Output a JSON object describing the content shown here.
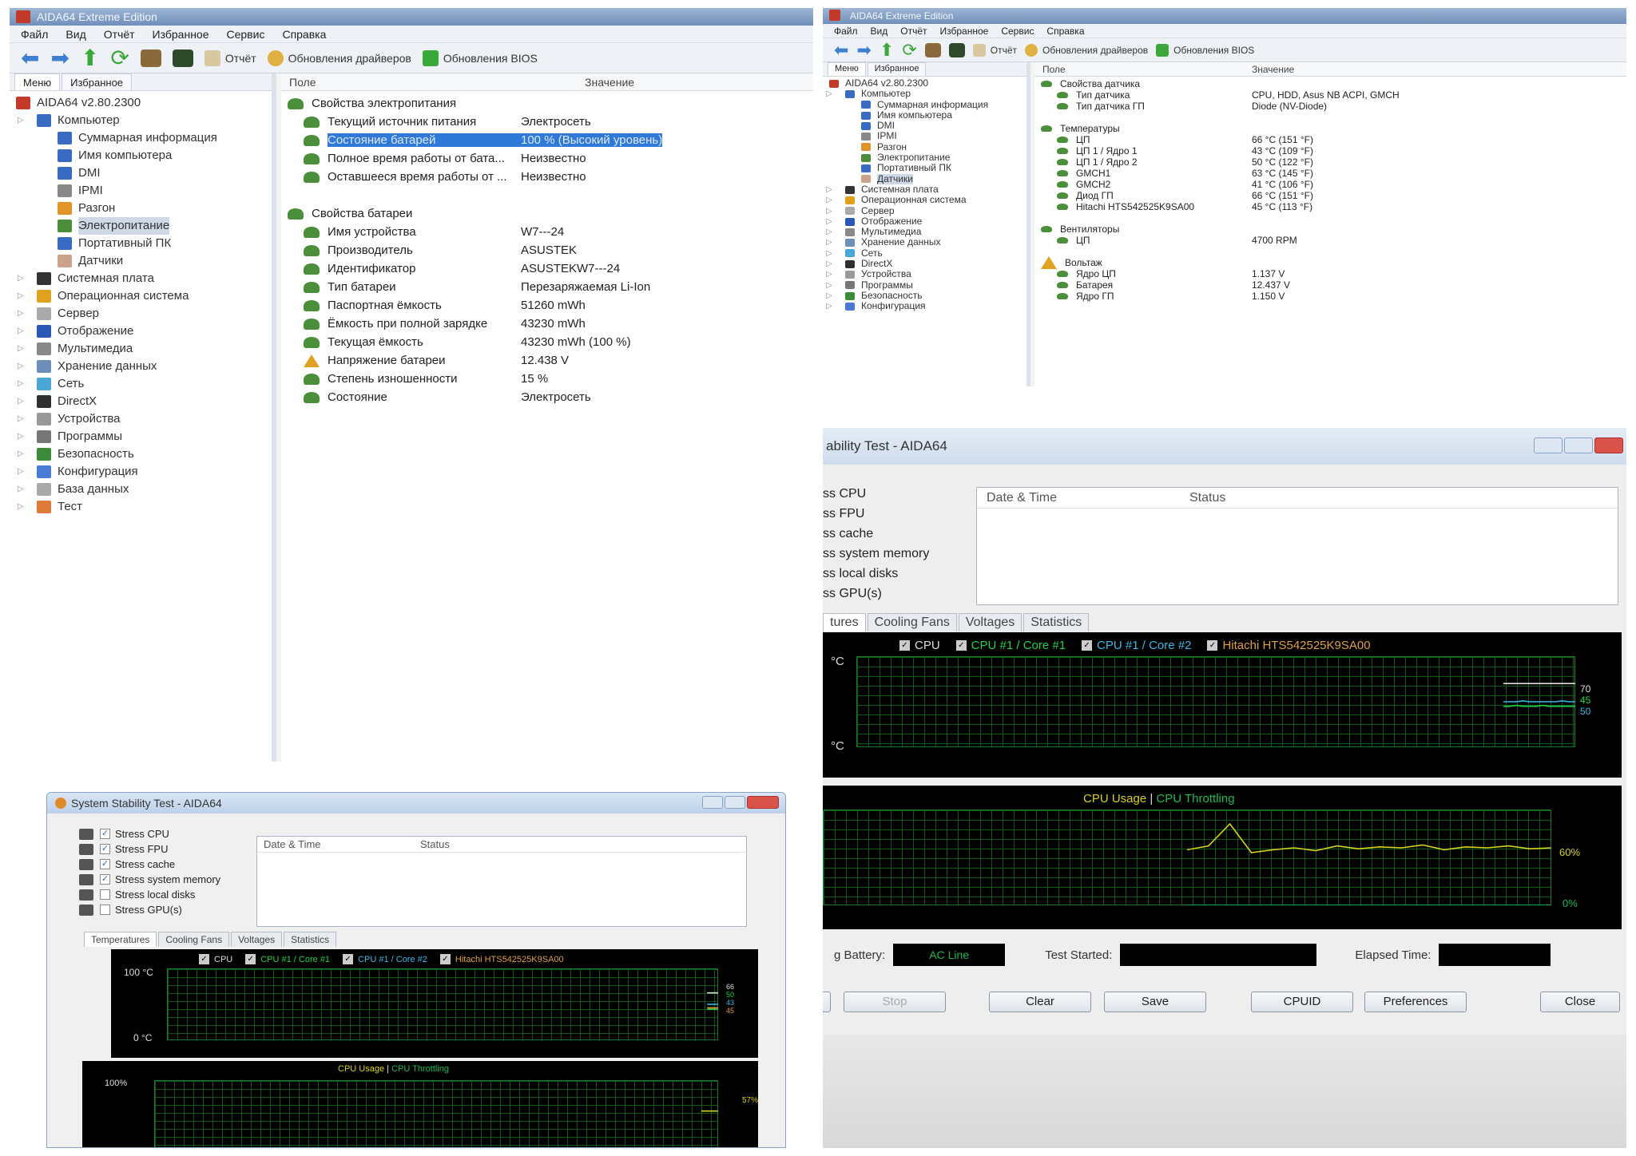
{
  "aida_left": {
    "title": "AIDA64 Extreme Edition",
    "menu": [
      "Файл",
      "Вид",
      "Отчёт",
      "Избранное",
      "Сервис",
      "Справка"
    ],
    "toolbar": {
      "report": "Отчёт",
      "drivers": "Обновления драйверов",
      "bios": "Обновления BIOS"
    },
    "tabs": [
      "Меню",
      "Избранное"
    ],
    "tree": [
      {
        "label": "AIDA64 v2.80.2300",
        "level": 0,
        "icon": "aida-icon",
        "color": "#c43a2a"
      },
      {
        "label": "Компьютер",
        "level": 1,
        "icon": "computer-icon",
        "color": "#3a6bc4"
      },
      {
        "label": "Суммарная информация",
        "level": 2,
        "icon": "summary-icon",
        "color": "#3a6bc4"
      },
      {
        "label": "Имя компьютера",
        "level": 2,
        "icon": "computer-name-icon",
        "color": "#3a6bc4"
      },
      {
        "label": "DMI",
        "level": 2,
        "icon": "dmi-icon",
        "color": "#3a6bc4"
      },
      {
        "label": "IPMI",
        "level": 2,
        "icon": "ipmi-icon",
        "color": "#888"
      },
      {
        "label": "Разгон",
        "level": 2,
        "icon": "overclock-icon",
        "color": "#e0942a"
      },
      {
        "label": "Электропитание",
        "level": 2,
        "icon": "power-icon",
        "color": "#4b8f3a",
        "selected": true
      },
      {
        "label": "Портативный ПК",
        "level": 2,
        "icon": "laptop-icon",
        "color": "#3a6bc4"
      },
      {
        "label": "Датчики",
        "level": 2,
        "icon": "sensors-icon",
        "color": "#c9a48a"
      },
      {
        "label": "Системная плата",
        "level": 1,
        "icon": "motherboard-icon",
        "color": "#333"
      },
      {
        "label": "Операционная система",
        "level": 1,
        "icon": "os-icon",
        "color": "#e0a020"
      },
      {
        "label": "Сервер",
        "level": 1,
        "icon": "server-icon",
        "color": "#aaa"
      },
      {
        "label": "Отображение",
        "level": 1,
        "icon": "display-icon",
        "color": "#2a58b8"
      },
      {
        "label": "Мультимедиа",
        "level": 1,
        "icon": "multimedia-icon",
        "color": "#888"
      },
      {
        "label": "Хранение данных",
        "level": 1,
        "icon": "storage-icon",
        "color": "#6f8fbb"
      },
      {
        "label": "Сеть",
        "level": 1,
        "icon": "network-icon",
        "color": "#4aa8d8"
      },
      {
        "label": "DirectX",
        "level": 1,
        "icon": "directx-icon",
        "color": "#2f2f2f"
      },
      {
        "label": "Устройства",
        "level": 1,
        "icon": "devices-icon",
        "color": "#999"
      },
      {
        "label": "Программы",
        "level": 1,
        "icon": "programs-icon",
        "color": "#777"
      },
      {
        "label": "Безопасность",
        "level": 1,
        "icon": "security-icon",
        "color": "#3a8a3a"
      },
      {
        "label": "Конфигурация",
        "level": 1,
        "icon": "config-icon",
        "color": "#4a7ad8"
      },
      {
        "label": "База данных",
        "level": 1,
        "icon": "database-icon",
        "color": "#aaa"
      },
      {
        "label": "Тест",
        "level": 1,
        "icon": "test-icon",
        "color": "#e07a3a"
      }
    ],
    "col_field": "Поле",
    "col_value": "Значение",
    "rows": [
      {
        "field": "Свойства электропитания",
        "value": "",
        "type": "group"
      },
      {
        "field": "Текущий источник питания",
        "value": "Электросеть"
      },
      {
        "field": "Состояние батарей",
        "value": "100 % (Высокий уровень)",
        "highlight": true
      },
      {
        "field": "Полное время работы от бата...",
        "value": "Неизвестно"
      },
      {
        "field": "Оставшееся время работы от ...",
        "value": "Неизвестно"
      },
      {
        "field": "",
        "value": "",
        "type": "spacer"
      },
      {
        "field": "Свойства батареи",
        "value": "",
        "type": "group"
      },
      {
        "field": "Имя устройства",
        "value": "W7---24"
      },
      {
        "field": "Производитель",
        "value": "ASUSTEK"
      },
      {
        "field": "Идентификатор",
        "value": "ASUSTEKW7---24"
      },
      {
        "field": "Тип батареи",
        "value": "Перезаряжаемая Li-Ion"
      },
      {
        "field": "Паспортная ёмкость",
        "value": "51260 mWh"
      },
      {
        "field": "Ёмкость при полной зарядке",
        "value": "43230 mWh"
      },
      {
        "field": "Текущая ёмкость",
        "value": "43230 mWh  (100 %)"
      },
      {
        "field": "Напряжение батареи",
        "value": "12.438 V",
        "warn": true
      },
      {
        "field": "Степень изношенности",
        "value": "15 %"
      },
      {
        "field": "Состояние",
        "value": "Электросеть"
      }
    ]
  },
  "aida_right": {
    "title": "AIDA64 Extreme Edition",
    "menu": [
      "Файл",
      "Вид",
      "Отчёт",
      "Избранное",
      "Сервис",
      "Справка"
    ],
    "toolbar": {
      "report": "Отчёт",
      "drivers": "Обновления драйверов",
      "bios": "Обновления BIOS"
    },
    "tabs": [
      "Меню",
      "Избранное"
    ],
    "tree": [
      {
        "label": "AIDA64 v2.80.2300",
        "level": 0,
        "icon": "aida-icon",
        "color": "#c43a2a"
      },
      {
        "label": "Компьютер",
        "level": 1,
        "icon": "computer-icon",
        "color": "#3a6bc4"
      },
      {
        "label": "Суммарная информация",
        "level": 2,
        "icon": "summary-icon",
        "color": "#3a6bc4"
      },
      {
        "label": "Имя компьютера",
        "level": 2,
        "icon": "computer-name-icon",
        "color": "#3a6bc4"
      },
      {
        "label": "DMI",
        "level": 2,
        "icon": "dmi-icon",
        "color": "#3a6bc4"
      },
      {
        "label": "IPMI",
        "level": 2,
        "icon": "ipmi-icon",
        "color": "#888"
      },
      {
        "label": "Разгон",
        "level": 2,
        "icon": "overclock-icon",
        "color": "#e0942a"
      },
      {
        "label": "Электропитание",
        "level": 2,
        "icon": "power-icon",
        "color": "#4b8f3a"
      },
      {
        "label": "Портативный ПК",
        "level": 2,
        "icon": "laptop-icon",
        "color": "#3a6bc4"
      },
      {
        "label": "Датчики",
        "level": 2,
        "icon": "sensors-icon",
        "color": "#c9a48a",
        "selected": true
      },
      {
        "label": "Системная плата",
        "level": 1,
        "icon": "motherboard-icon",
        "color": "#333"
      },
      {
        "label": "Операционная система",
        "level": 1,
        "icon": "os-icon",
        "color": "#e0a020"
      },
      {
        "label": "Сервер",
        "level": 1,
        "icon": "server-icon",
        "color": "#aaa"
      },
      {
        "label": "Отображение",
        "level": 1,
        "icon": "display-icon",
        "color": "#2a58b8"
      },
      {
        "label": "Мультимедиа",
        "level": 1,
        "icon": "multimedia-icon",
        "color": "#888"
      },
      {
        "label": "Хранение данных",
        "level": 1,
        "icon": "storage-icon",
        "color": "#6f8fbb"
      },
      {
        "label": "Сеть",
        "level": 1,
        "icon": "network-icon",
        "color": "#4aa8d8"
      },
      {
        "label": "DirectX",
        "level": 1,
        "icon": "directx-icon",
        "color": "#2f2f2f"
      },
      {
        "label": "Устройства",
        "level": 1,
        "icon": "devices-icon",
        "color": "#999"
      },
      {
        "label": "Программы",
        "level": 1,
        "icon": "programs-icon",
        "color": "#777"
      },
      {
        "label": "Безопасность",
        "level": 1,
        "icon": "security-icon",
        "color": "#3a8a3a"
      },
      {
        "label": "Конфигурация",
        "level": 1,
        "icon": "config-icon",
        "color": "#4a7ad8"
      }
    ],
    "col_field": "Поле",
    "col_value": "Значение",
    "rows": [
      {
        "field": "Свойства датчика",
        "value": "",
        "type": "group"
      },
      {
        "field": "Тип датчика",
        "value": "CPU, HDD, Asus NB ACPI, GMCH"
      },
      {
        "field": "Тип датчика ГП",
        "value": "Diode  (NV-Diode)"
      },
      {
        "field": "",
        "value": "",
        "type": "spacer"
      },
      {
        "field": "Температуры",
        "value": "",
        "type": "group"
      },
      {
        "field": "ЦП",
        "value": "66 °C  (151 °F)"
      },
      {
        "field": "ЦП 1 / Ядро 1",
        "value": "43 °C  (109 °F)"
      },
      {
        "field": "ЦП 1 / Ядро 2",
        "value": "50 °C  (122 °F)"
      },
      {
        "field": "GMCH1",
        "value": "63 °C  (145 °F)"
      },
      {
        "field": "GMCH2",
        "value": "41 °C  (106 °F)"
      },
      {
        "field": "Диод ГП",
        "value": "66 °C  (151 °F)"
      },
      {
        "field": "Hitachi HTS542525K9SA00",
        "value": "45 °C  (113 °F)"
      },
      {
        "field": "",
        "value": "",
        "type": "spacer"
      },
      {
        "field": "Вентиляторы",
        "value": "",
        "type": "group"
      },
      {
        "field": "ЦП",
        "value": "4700 RPM"
      },
      {
        "field": "",
        "value": "",
        "type": "spacer"
      },
      {
        "field": "Вольтаж",
        "value": "",
        "type": "group",
        "warn": true
      },
      {
        "field": "Ядро ЦП",
        "value": "1.137 V"
      },
      {
        "field": "Батарея",
        "value": "12.437 V"
      },
      {
        "field": "Ядро ГП",
        "value": "1.150 V"
      }
    ]
  },
  "stab_small": {
    "title": "System Stability Test - AIDA64",
    "checks": [
      {
        "label": "Stress CPU",
        "checked": true,
        "icon": "cpu-icon"
      },
      {
        "label": "Stress FPU",
        "checked": true,
        "icon": "fpu-icon"
      },
      {
        "label": "Stress cache",
        "checked": true,
        "icon": "cache-icon"
      },
      {
        "label": "Stress system memory",
        "checked": true,
        "icon": "memory-icon"
      },
      {
        "label": "Stress local disks",
        "checked": false,
        "icon": "disk-icon"
      },
      {
        "label": "Stress GPU(s)",
        "checked": false,
        "icon": "gpu-icon"
      }
    ],
    "log_cols": [
      "Date & Time",
      "Status"
    ],
    "tabs": [
      "Temperatures",
      "Cooling Fans",
      "Voltages",
      "Statistics"
    ],
    "legend": [
      "CPU",
      "CPU #1 / Core #1",
      "CPU #1 / Core #2",
      "Hitachi HTS542525K9SA00"
    ],
    "temp_top": "100 °C",
    "temp_bottom": "0 °C",
    "temp_vals": [
      "66",
      "50",
      "43",
      "45"
    ],
    "usage_title": "CPU Usage",
    "throttle_title": "CPU Throttling",
    "usage_top": "100%",
    "usage_val": "57%"
  },
  "stab_big": {
    "title": "ability Test - AIDA64",
    "checks": [
      "ss CPU",
      "ss FPU",
      "ss cache",
      "ss system memory",
      "ss local disks",
      "ss GPU(s)"
    ],
    "log_cols": [
      "Date & Time",
      "Status"
    ],
    "tabs": [
      "tures",
      "Cooling Fans",
      "Voltages",
      "Statistics"
    ],
    "legend": [
      "CPU",
      "CPU #1 / Core #1",
      "CPU #1 / Core #2",
      "Hitachi HTS542525K9SA00"
    ],
    "temp_top": "°C",
    "temp_bottom": "°C",
    "temp_vals": [
      "70",
      "45",
      "50"
    ],
    "usage_title": "CPU Usage",
    "throttle_title": "CPU Throttling",
    "usage_val": "60%",
    "usage_bottom": "0%",
    "battery_label": "g Battery:",
    "battery_value": "AC Line",
    "test_started_label": "Test Started:",
    "elapsed_label": "Elapsed Time:",
    "buttons": {
      "start": "",
      "stop": "Stop",
      "clear": "Clear",
      "save": "Save",
      "cpuid": "CPUID",
      "prefs": "Preferences",
      "close": "Close"
    }
  },
  "colors": {
    "cpu": "#dddddd",
    "core1": "#1fd14a",
    "core2": "#39b9e8",
    "hdd": "#e0a040",
    "usage": "#d7d21f",
    "throttle": "#1db954",
    "grid": "#0d5a16",
    "select": "#2f7ad9"
  },
  "chart_data": [
    {
      "type": "line",
      "title": "",
      "ylabel": "°C",
      "ylim": [
        0,
        100
      ],
      "series": [
        {
          "name": "CPU",
          "values": [
            66,
            66,
            66,
            66,
            66,
            66,
            66,
            66
          ]
        },
        {
          "name": "CPU #1 / Core #1",
          "values": [
            43,
            43,
            43,
            43,
            43,
            43,
            43,
            43
          ]
        },
        {
          "name": "CPU #1 / Core #2",
          "values": [
            50,
            50,
            50,
            50,
            50,
            50,
            50,
            50
          ]
        },
        {
          "name": "Hitachi HTS542525K9SA00",
          "values": [
            45,
            45,
            45,
            45,
            45,
            45,
            45,
            45
          ]
        }
      ]
    },
    {
      "type": "line",
      "title": "",
      "ylim": [
        0,
        100
      ],
      "series": [
        {
          "name": "CPU Usage",
          "values": [
            57,
            57,
            57,
            57,
            57,
            57
          ]
        },
        {
          "name": "CPU Throttling",
          "values": [
            0,
            0,
            0,
            0,
            0,
            0
          ]
        }
      ]
    },
    {
      "type": "line",
      "title": "",
      "ylabel": "°C",
      "ylim": [
        0,
        100
      ],
      "series": [
        {
          "name": "CPU",
          "values": [
            70,
            70,
            70,
            70,
            70,
            70,
            70,
            70,
            70,
            70,
            70,
            70
          ]
        },
        {
          "name": "CPU #1 / Core #1",
          "values": [
            45,
            45,
            46,
            45,
            45,
            45,
            46,
            45,
            45,
            45,
            45,
            45
          ]
        },
        {
          "name": "CPU #1 / Core #2",
          "values": [
            50,
            50,
            50,
            51,
            50,
            50,
            50,
            50,
            50,
            51,
            50,
            50
          ]
        }
      ]
    },
    {
      "type": "line",
      "title": "",
      "ylim": [
        0,
        100
      ],
      "series": [
        {
          "name": "CPU Usage",
          "values": [
            58,
            62,
            85,
            55,
            58,
            60,
            57,
            62,
            59,
            61,
            60,
            63,
            58,
            61,
            60,
            62,
            59,
            60
          ]
        },
        {
          "name": "CPU Throttling",
          "values": [
            0,
            0,
            0,
            0,
            0,
            0,
            0,
            0,
            0,
            0,
            0,
            0,
            0,
            0,
            0,
            0,
            0,
            0
          ]
        }
      ]
    }
  ]
}
